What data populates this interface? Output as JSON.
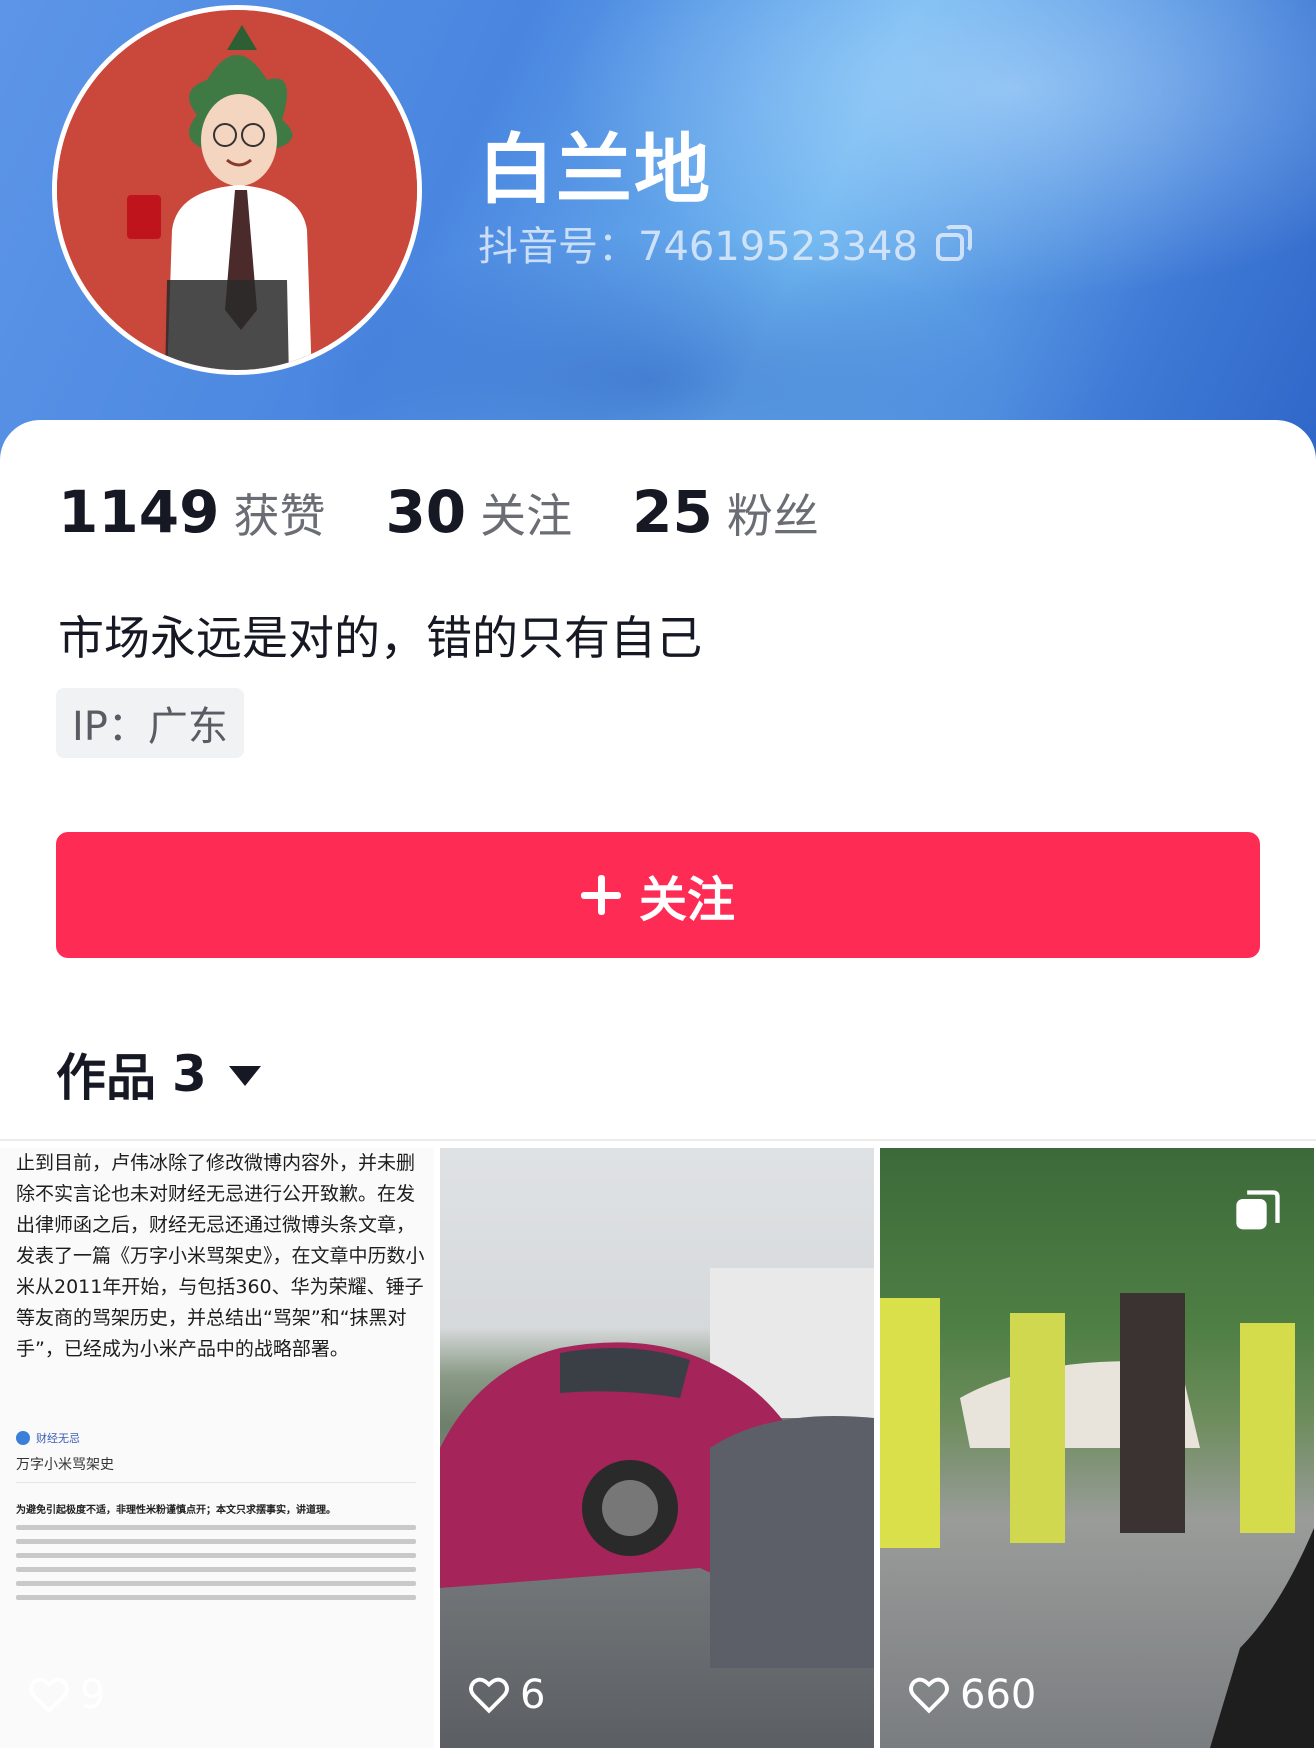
{
  "profile": {
    "name": "白兰地",
    "douyin_id": "抖音号：74619523348"
  },
  "stats": [
    {
      "num": "1149",
      "label": "获赞"
    },
    {
      "num": "30",
      "label": "关注"
    },
    {
      "num": "25",
      "label": "粉丝"
    }
  ],
  "bio": "市场永远是对的，错的只有自己",
  "ip": "IP：广东",
  "follow_button": "关注",
  "works": {
    "label": "作品",
    "count": "3"
  },
  "tiles": [
    {
      "likes": "9",
      "article": "止到目前，卢伟冰除了修改微博内容外，并未删除不实言论也未对财经无忌进行公开致歉。在发出律师函之后，财经无忌还通过微博头条文章，发表了一篇《万字小米骂架史》，在文章中历数小米从2011年开始，与包括360、华为荣耀、锤子等友商的骂架历史，并总结出“骂架”和“抹黑对手”，已经成为小米产品中的战略部署。",
      "doc_source": "财经无忌",
      "doc_title": "万字小米骂架史",
      "doc_bold": "为避免引起极度不适，非理性米粉谨慎点开；本文只求摆事实，讲道理。"
    },
    {
      "likes": "6"
    },
    {
      "likes": "660"
    }
  ],
  "colors": {
    "accent": "#fe2c55",
    "header_blue": "#4a86e0"
  }
}
